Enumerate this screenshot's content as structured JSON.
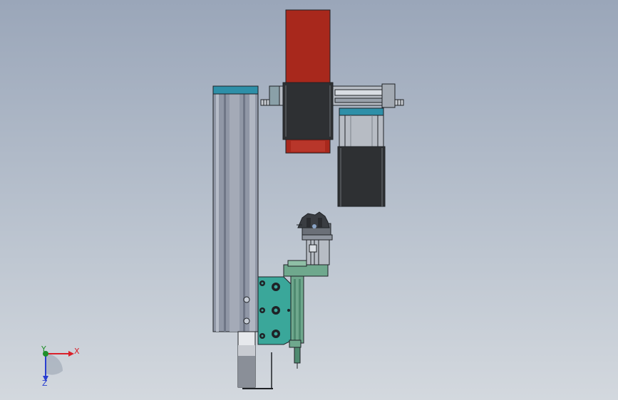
{
  "viewport": {
    "background_top": "#9aa6b9",
    "background_bottom": "#d3d8de"
  },
  "model": {
    "colors": {
      "motor_red": "#a8281c",
      "motor_black": "#2e3033",
      "rail_grey": "#9097a6",
      "rail_cap_teal": "#2e8fa8",
      "plate_teal": "#3aa79a",
      "bracket_green": "#6fa88d",
      "cylinder_grey": "#b7bcc4",
      "outline": "#1f2226"
    }
  },
  "triad": {
    "x_label": "X",
    "y_label": "Y",
    "z_label": "Z",
    "x_color": "#d9202a",
    "y_color": "#1f8f2a",
    "z_color": "#2a3fd0"
  }
}
